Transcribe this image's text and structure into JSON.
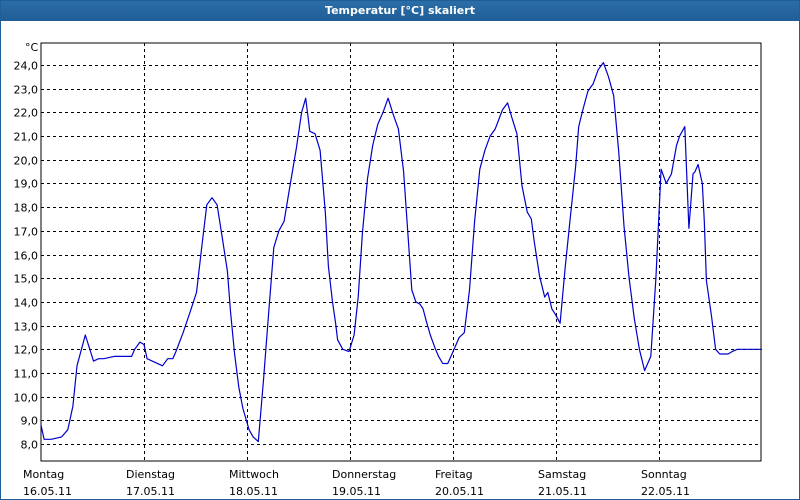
{
  "window": {
    "title": "Temperatur [°C] skaliert"
  },
  "chart_data": {
    "type": "line",
    "title": "Temperatur [°C] skaliert",
    "ylabel": "°C",
    "xlabel": "",
    "ylim": [
      7.5,
      24.8
    ],
    "yticks": [
      8.0,
      9.0,
      10.0,
      11.0,
      12.0,
      13.0,
      14.0,
      15.0,
      16.0,
      17.0,
      18.0,
      19.0,
      20.0,
      21.0,
      22.0,
      23.0,
      24.0
    ],
    "ytick_labels": [
      "8,0",
      "9,0",
      "10,0",
      "11,0",
      "12,0",
      "13,0",
      "14,0",
      "15,0",
      "16,0",
      "17,0",
      "18,0",
      "19,0",
      "20,0",
      "21,0",
      "22,0",
      "23,0",
      "24,0"
    ],
    "grid": true,
    "line_color": "#0000cc",
    "x_range_days": [
      0,
      7
    ],
    "days": [
      {
        "weekday": "Montag",
        "date": "16.05.11"
      },
      {
        "weekday": "Dienstag",
        "date": "17.05.11"
      },
      {
        "weekday": "Mittwoch",
        "date": "18.05.11"
      },
      {
        "weekday": "Donnerstag",
        "date": "19.05.11"
      },
      {
        "weekday": "Freitag",
        "date": "20.05.11"
      },
      {
        "weekday": "Samstag",
        "date": "21.05.11"
      },
      {
        "weekday": "Sonntag",
        "date": "22.05.11"
      }
    ],
    "series": [
      {
        "x": [
          0.0,
          0.03,
          0.1,
          0.2,
          0.26,
          0.31,
          0.35,
          0.43,
          0.51,
          0.56,
          0.61,
          0.71,
          0.8,
          0.88,
          0.91,
          0.96,
          1.0,
          1.03,
          1.08,
          1.18,
          1.23,
          1.28,
          1.31,
          1.38,
          1.45,
          1.51,
          1.56,
          1.61,
          1.66,
          1.71,
          1.76,
          1.81,
          1.84,
          1.88,
          1.92,
          1.96,
          2.02,
          2.06,
          2.11,
          2.16,
          2.21,
          2.26,
          2.31,
          2.36,
          2.41,
          2.48,
          2.53,
          2.57,
          2.61,
          2.66,
          2.71,
          2.76,
          2.79,
          2.83,
          2.86,
          2.88,
          2.93,
          2.99,
          3.04,
          3.08,
          3.12,
          3.17,
          3.22,
          3.27,
          3.32,
          3.37,
          3.42,
          3.47,
          3.52,
          3.56,
          3.6,
          3.64,
          3.68,
          3.71,
          3.74,
          3.78,
          3.83,
          3.86,
          3.9,
          3.95,
          4.02,
          4.06,
          4.11,
          4.16,
          4.21,
          4.26,
          4.31,
          4.36,
          4.41,
          4.48,
          4.53,
          4.57,
          4.62,
          4.67,
          4.72,
          4.76,
          4.79,
          4.84,
          4.89,
          4.92,
          4.96,
          4.99,
          5.04,
          5.09,
          5.14,
          5.19,
          5.22,
          5.26,
          5.31,
          5.36,
          5.41,
          5.46,
          5.51,
          5.56,
          5.61,
          5.66,
          5.71,
          5.76,
          5.81,
          5.86,
          5.92,
          5.97,
          6.02,
          6.07,
          6.12,
          6.17,
          6.2,
          6.25,
          6.29,
          6.33,
          6.35,
          6.38,
          6.42,
          6.44,
          6.46,
          6.51,
          6.55,
          6.59,
          6.63,
          6.67,
          6.71,
          6.76,
          6.81,
          6.85,
          6.9,
          6.96,
          7.0
        ],
        "y": [
          8.8,
          8.2,
          8.2,
          8.3,
          8.6,
          9.6,
          11.3,
          12.6,
          11.5,
          11.6,
          11.6,
          11.7,
          11.7,
          11.7,
          12.0,
          12.3,
          12.2,
          11.6,
          11.5,
          11.3,
          11.6,
          11.6,
          11.9,
          12.7,
          13.6,
          14.4,
          16.3,
          18.1,
          18.4,
          18.1,
          16.7,
          15.3,
          13.6,
          11.8,
          10.4,
          9.5,
          8.6,
          8.3,
          8.1,
          10.7,
          13.5,
          16.3,
          17.0,
          17.4,
          18.7,
          20.5,
          22.0,
          22.6,
          21.2,
          21.1,
          20.4,
          17.8,
          15.5,
          14.0,
          13.1,
          12.4,
          12.0,
          11.9,
          12.6,
          14.2,
          16.9,
          19.2,
          20.6,
          21.5,
          22.0,
          22.6,
          21.9,
          21.3,
          19.5,
          17.0,
          14.5,
          14.0,
          13.9,
          13.7,
          13.2,
          12.6,
          12.0,
          11.7,
          11.4,
          11.4,
          12.1,
          12.5,
          12.7,
          14.5,
          17.4,
          19.6,
          20.4,
          21.0,
          21.3,
          22.1,
          22.4,
          21.8,
          21.1,
          18.9,
          17.8,
          17.5,
          16.5,
          15.1,
          14.2,
          14.4,
          13.7,
          13.5,
          13.1,
          15.5,
          17.6,
          19.7,
          21.4,
          22.1,
          22.9,
          23.2,
          23.8,
          24.1,
          23.5,
          22.7,
          20.3,
          17.2,
          15.0,
          13.3,
          12.0,
          11.1,
          11.7,
          15.0,
          19.6,
          19.0,
          19.4,
          20.6,
          21.0,
          21.4,
          17.1,
          19.4,
          19.5,
          19.8,
          19.0,
          17.4,
          14.9,
          13.4,
          12.0,
          11.8,
          11.8,
          11.8,
          11.9,
          12.0,
          12.0,
          12.0,
          12.0,
          12.0,
          12.0
        ]
      }
    ]
  }
}
